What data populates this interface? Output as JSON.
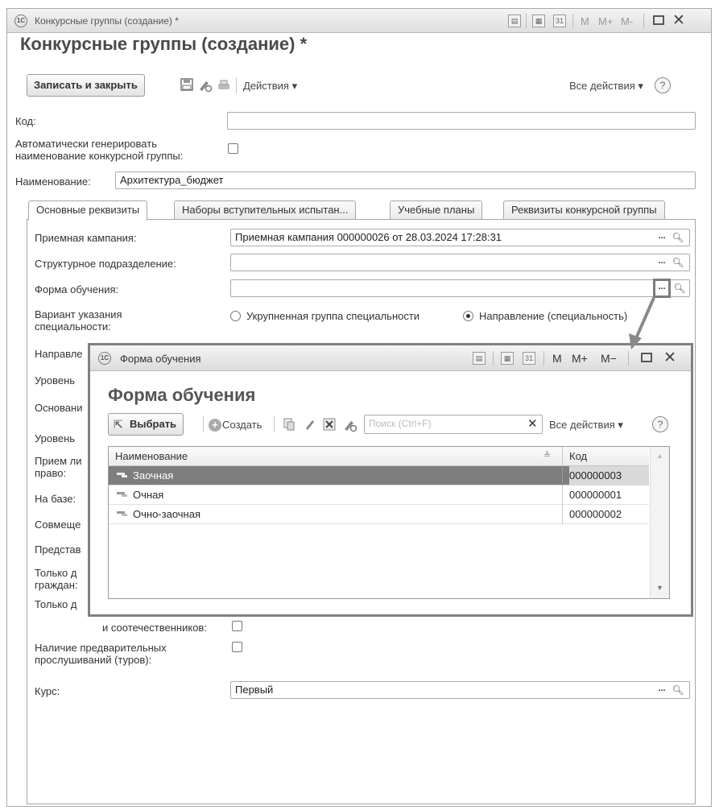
{
  "main_window": {
    "title": "Конкурсные группы (создание) *",
    "titlebar_m": "M",
    "titlebar_mplus": "M+",
    "titlebar_mminus": "M-",
    "calendar_label": "31"
  },
  "form": {
    "title": "Конкурсные группы (создание) *",
    "toolbar": {
      "save_close_label": "Записать и закрыть",
      "actions_label": "Действия ▾",
      "all_actions_label": "Все действия ▾",
      "help_label": "?"
    },
    "code": {
      "label": "Код:",
      "value": ""
    },
    "auto_generate": {
      "label_line1": "Автоматически генерировать",
      "label_line2": "наименование конкурсной группы:",
      "checked": false
    },
    "name": {
      "label": "Наименование:",
      "value": "Архитектура_бюджет"
    },
    "tabs": [
      {
        "label": "Основные реквизиты",
        "active": true
      },
      {
        "label": "Наборы вступительных испытан...",
        "active": false
      },
      {
        "label": "Учебные планы",
        "active": false
      },
      {
        "label": "Реквизиты конкурсной группы",
        "active": false
      }
    ],
    "fields": {
      "admission_campaign": {
        "label": "Приемная кампания:",
        "value": "Приемная кампания 000000026 от 28.03.2024 17:28:31"
      },
      "structural_unit": {
        "label": "Структурное подразделение:",
        "value": ""
      },
      "study_form": {
        "label": "Форма обучения:",
        "value": ""
      },
      "specialty_variant": {
        "label_line1": "Вариант указания",
        "label_line2": "специальности:",
        "option1": "Укрупненная группа специальности",
        "option2": "Направление (специальность)",
        "selected": 2
      },
      "direction_label": "Направле",
      "level_label": "Уровень",
      "basis_label": "Основани",
      "level2_label": "Уровень",
      "admission_line1": "Прием ли",
      "admission_line2": "право:",
      "base_label": "На базе:",
      "combine_label": "Совмеще",
      "represent_label": "Представ",
      "only_line1": "Только д",
      "only_line2": "граждан:",
      "only2_label": "Только д",
      "compatriots_label": "и соотечественников:",
      "preliminary_line1": "Наличие предварительных",
      "preliminary_line2": "прослушиваний (туров):",
      "course": {
        "label": "Курс:",
        "value": "Первый"
      }
    }
  },
  "popup": {
    "window_title": "Форма обучения",
    "heading": "Форма обучения",
    "select_label": "Выбрать",
    "create_label": "Создать",
    "search_placeholder": "Поиск (Ctrl+F)",
    "all_actions_label": "Все действия ▾",
    "help_label": "?",
    "titlebar_m": "M",
    "titlebar_mplus": "M+",
    "titlebar_mminus": "M−",
    "calendar_label": "31",
    "columns": [
      "Наименование",
      "Код"
    ],
    "rows": [
      {
        "name": "Заочная",
        "code": "000000003",
        "selected": true
      },
      {
        "name": "Очная",
        "code": "000000001",
        "selected": false
      },
      {
        "name": "Очно-заочная",
        "code": "000000002",
        "selected": false
      }
    ]
  },
  "icons": {
    "save": "floppy-icon",
    "edit": "pencil-gear-icon",
    "print": "printer-icon",
    "close": "close-icon",
    "maximize": "maximize-icon",
    "search": "magnifier-icon"
  }
}
